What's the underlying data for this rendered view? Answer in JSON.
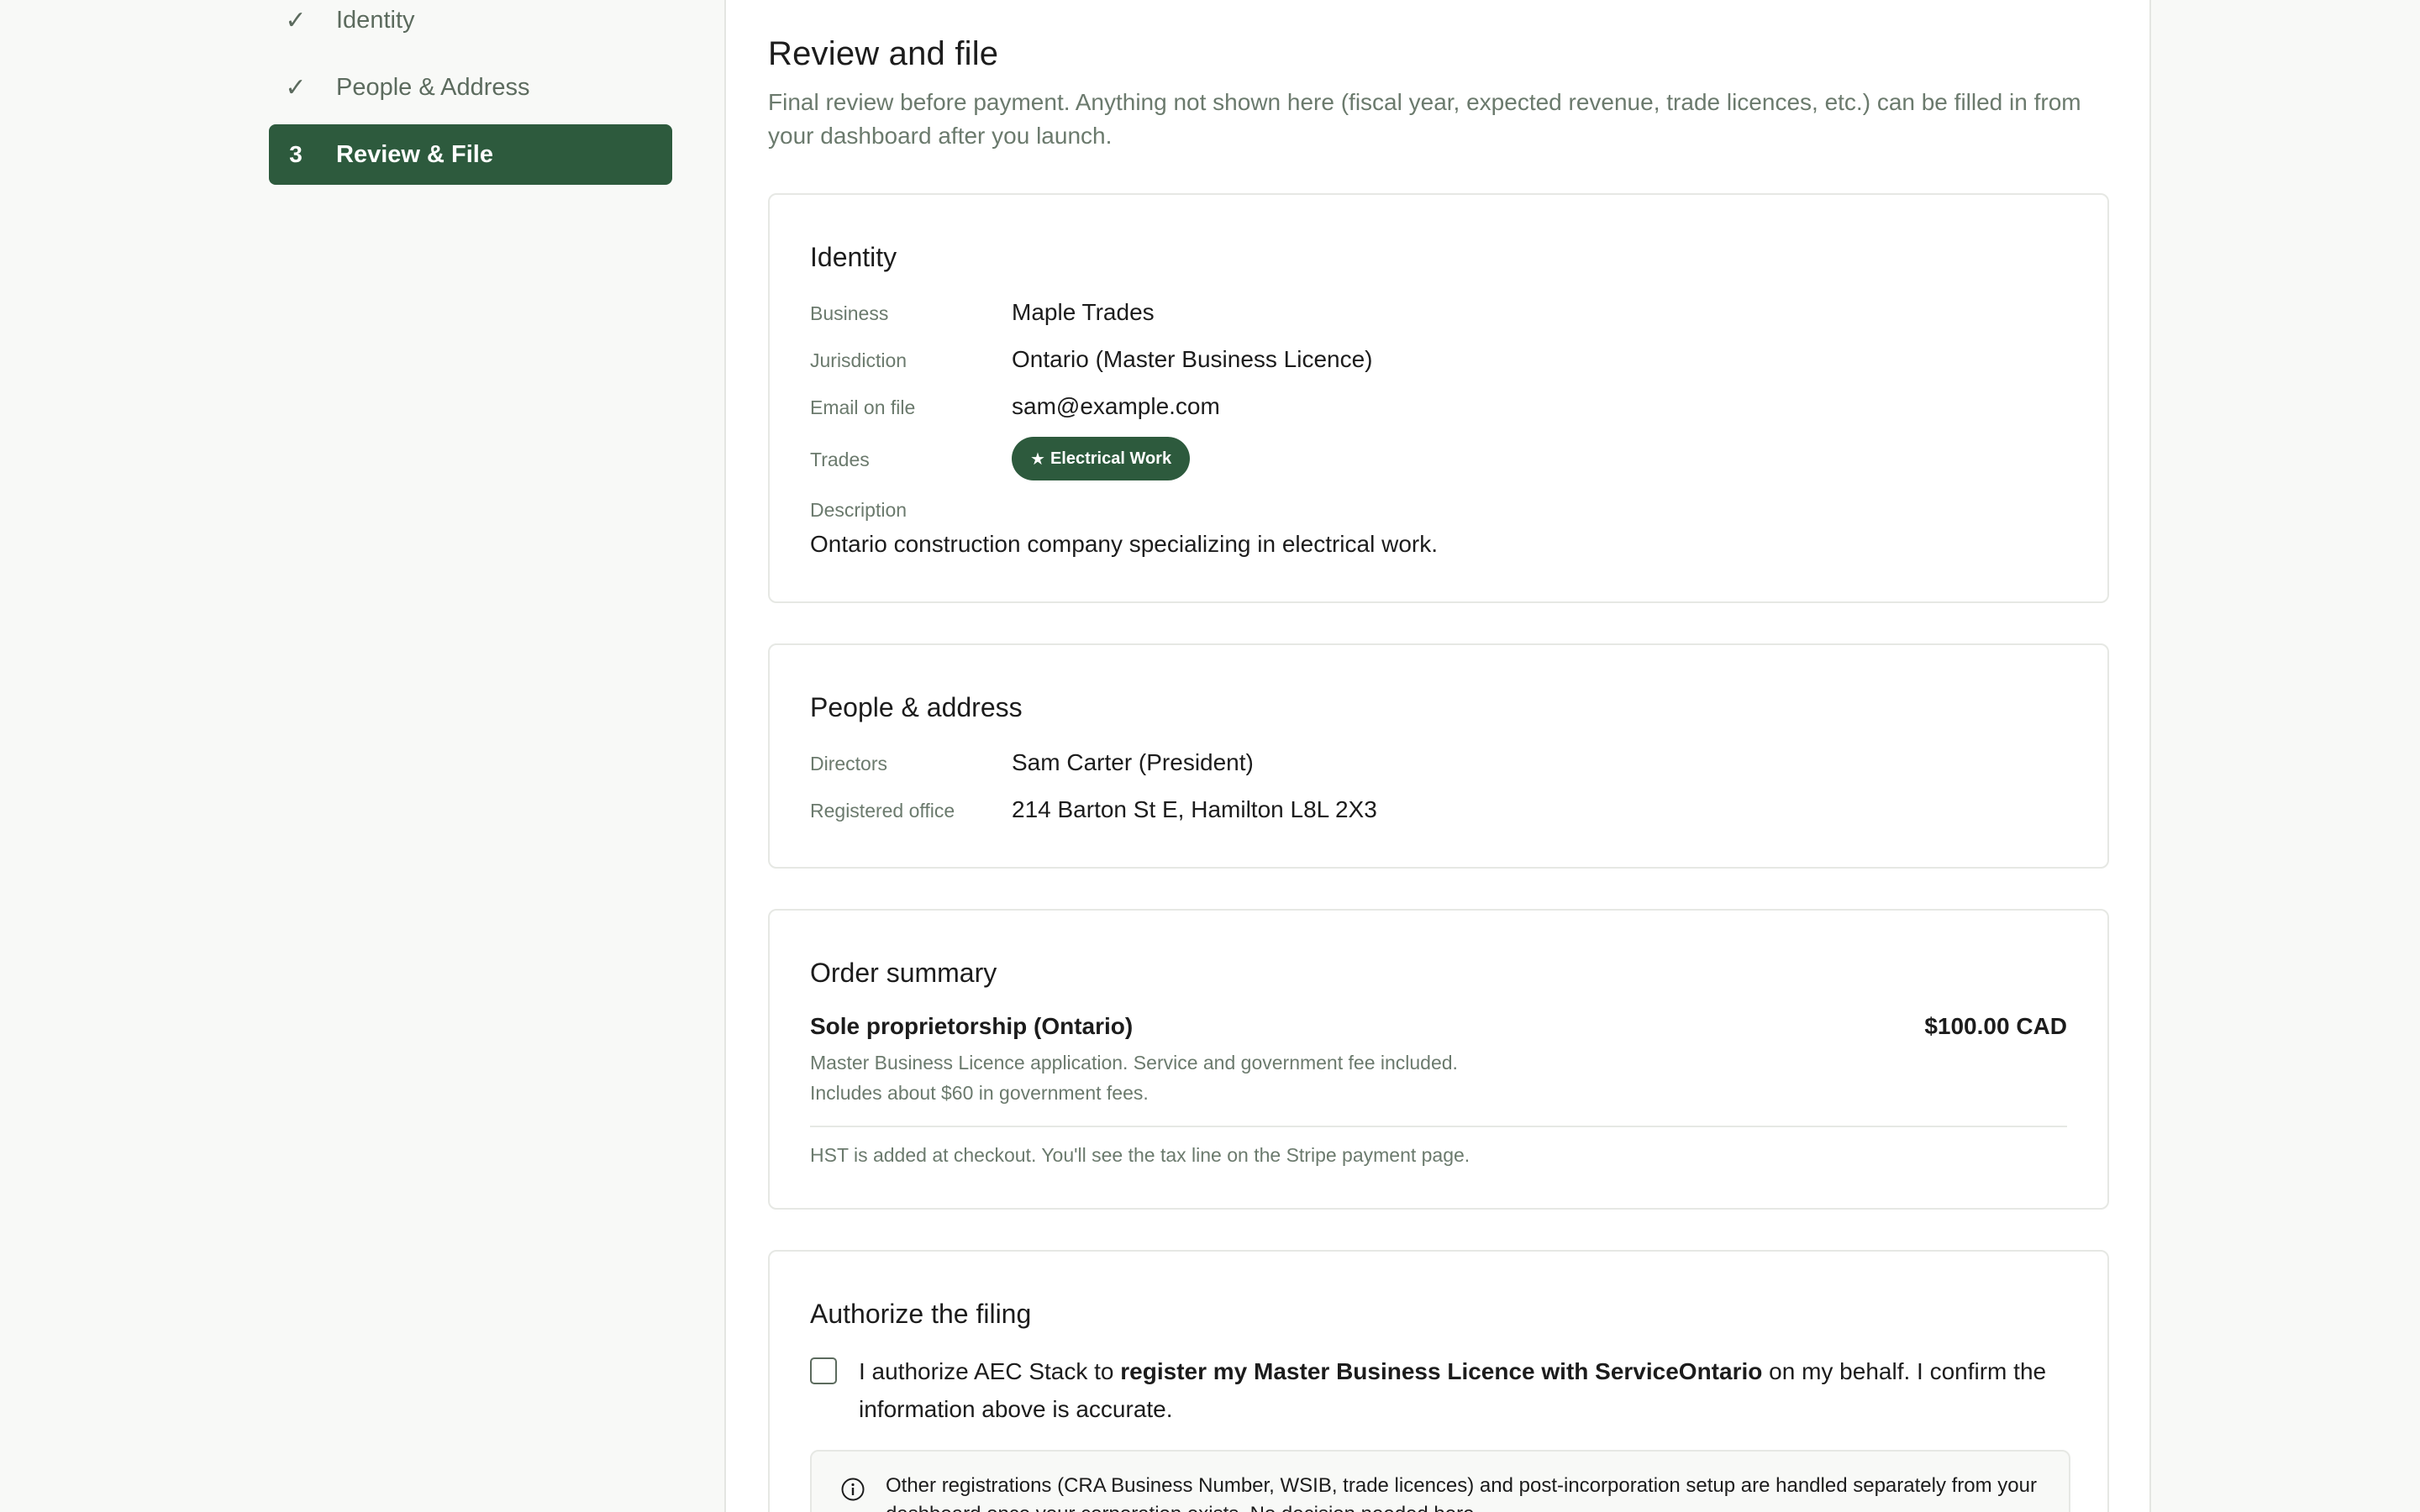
{
  "sidebar": {
    "steps": [
      {
        "mark": "✓",
        "label": "Identity"
      },
      {
        "mark": "✓",
        "label": "People & Address"
      },
      {
        "mark": "3",
        "label": "Review & File"
      }
    ]
  },
  "page": {
    "title": "Review and file",
    "subtitle": "Final review before payment. Anything not shown here (fiscal year, expected revenue, trade licences, etc.) can be filled in from your dashboard after you launch."
  },
  "identity": {
    "title": "Identity",
    "business_label": "Business",
    "business_value": "Maple Trades",
    "jurisdiction_label": "Jurisdiction",
    "jurisdiction_value": "Ontario (Master Business Licence)",
    "email_label": "Email on file",
    "email_value": "sam@example.com",
    "trades_label": "Trades",
    "trade_badge": "Electrical Work",
    "description_label": "Description",
    "description_value": "Ontario construction company specializing in electrical work."
  },
  "people": {
    "title": "People & address",
    "directors_label": "Directors",
    "directors_value": "Sam Carter (President)",
    "office_label": "Registered office",
    "office_value": "214 Barton St E, Hamilton L8L 2X3"
  },
  "order": {
    "title": "Order summary",
    "item_name": "Sole proprietorship (Ontario)",
    "item_price": "$100.00 CAD",
    "note_line1": "Master Business Licence application. Service and government fee included.",
    "note_line2": "Includes about $60 in government fees.",
    "tax_note": "HST is added at checkout. You'll see the tax line on the Stripe payment page."
  },
  "authorize": {
    "title": "Authorize the filing",
    "text_start": "I authorize AEC Stack to ",
    "text_bold": "register my Master Business Licence with ServiceOntario",
    "text_end": " on my behalf. I confirm the information above is accurate.",
    "checked": false,
    "info_text": "Other registrations (CRA Business Number, WSIB, trade licences) and post-incorporation setup are handled separately from your dashboard once your corporation exists. No decision needed here."
  },
  "colors": {
    "accent": "#2d5a3d",
    "muted_text": "#6b7a6d",
    "border": "#e6e8e4"
  },
  "icons": {
    "step_done": "check-icon",
    "badge": "star-icon",
    "info": "info-circle-icon"
  }
}
